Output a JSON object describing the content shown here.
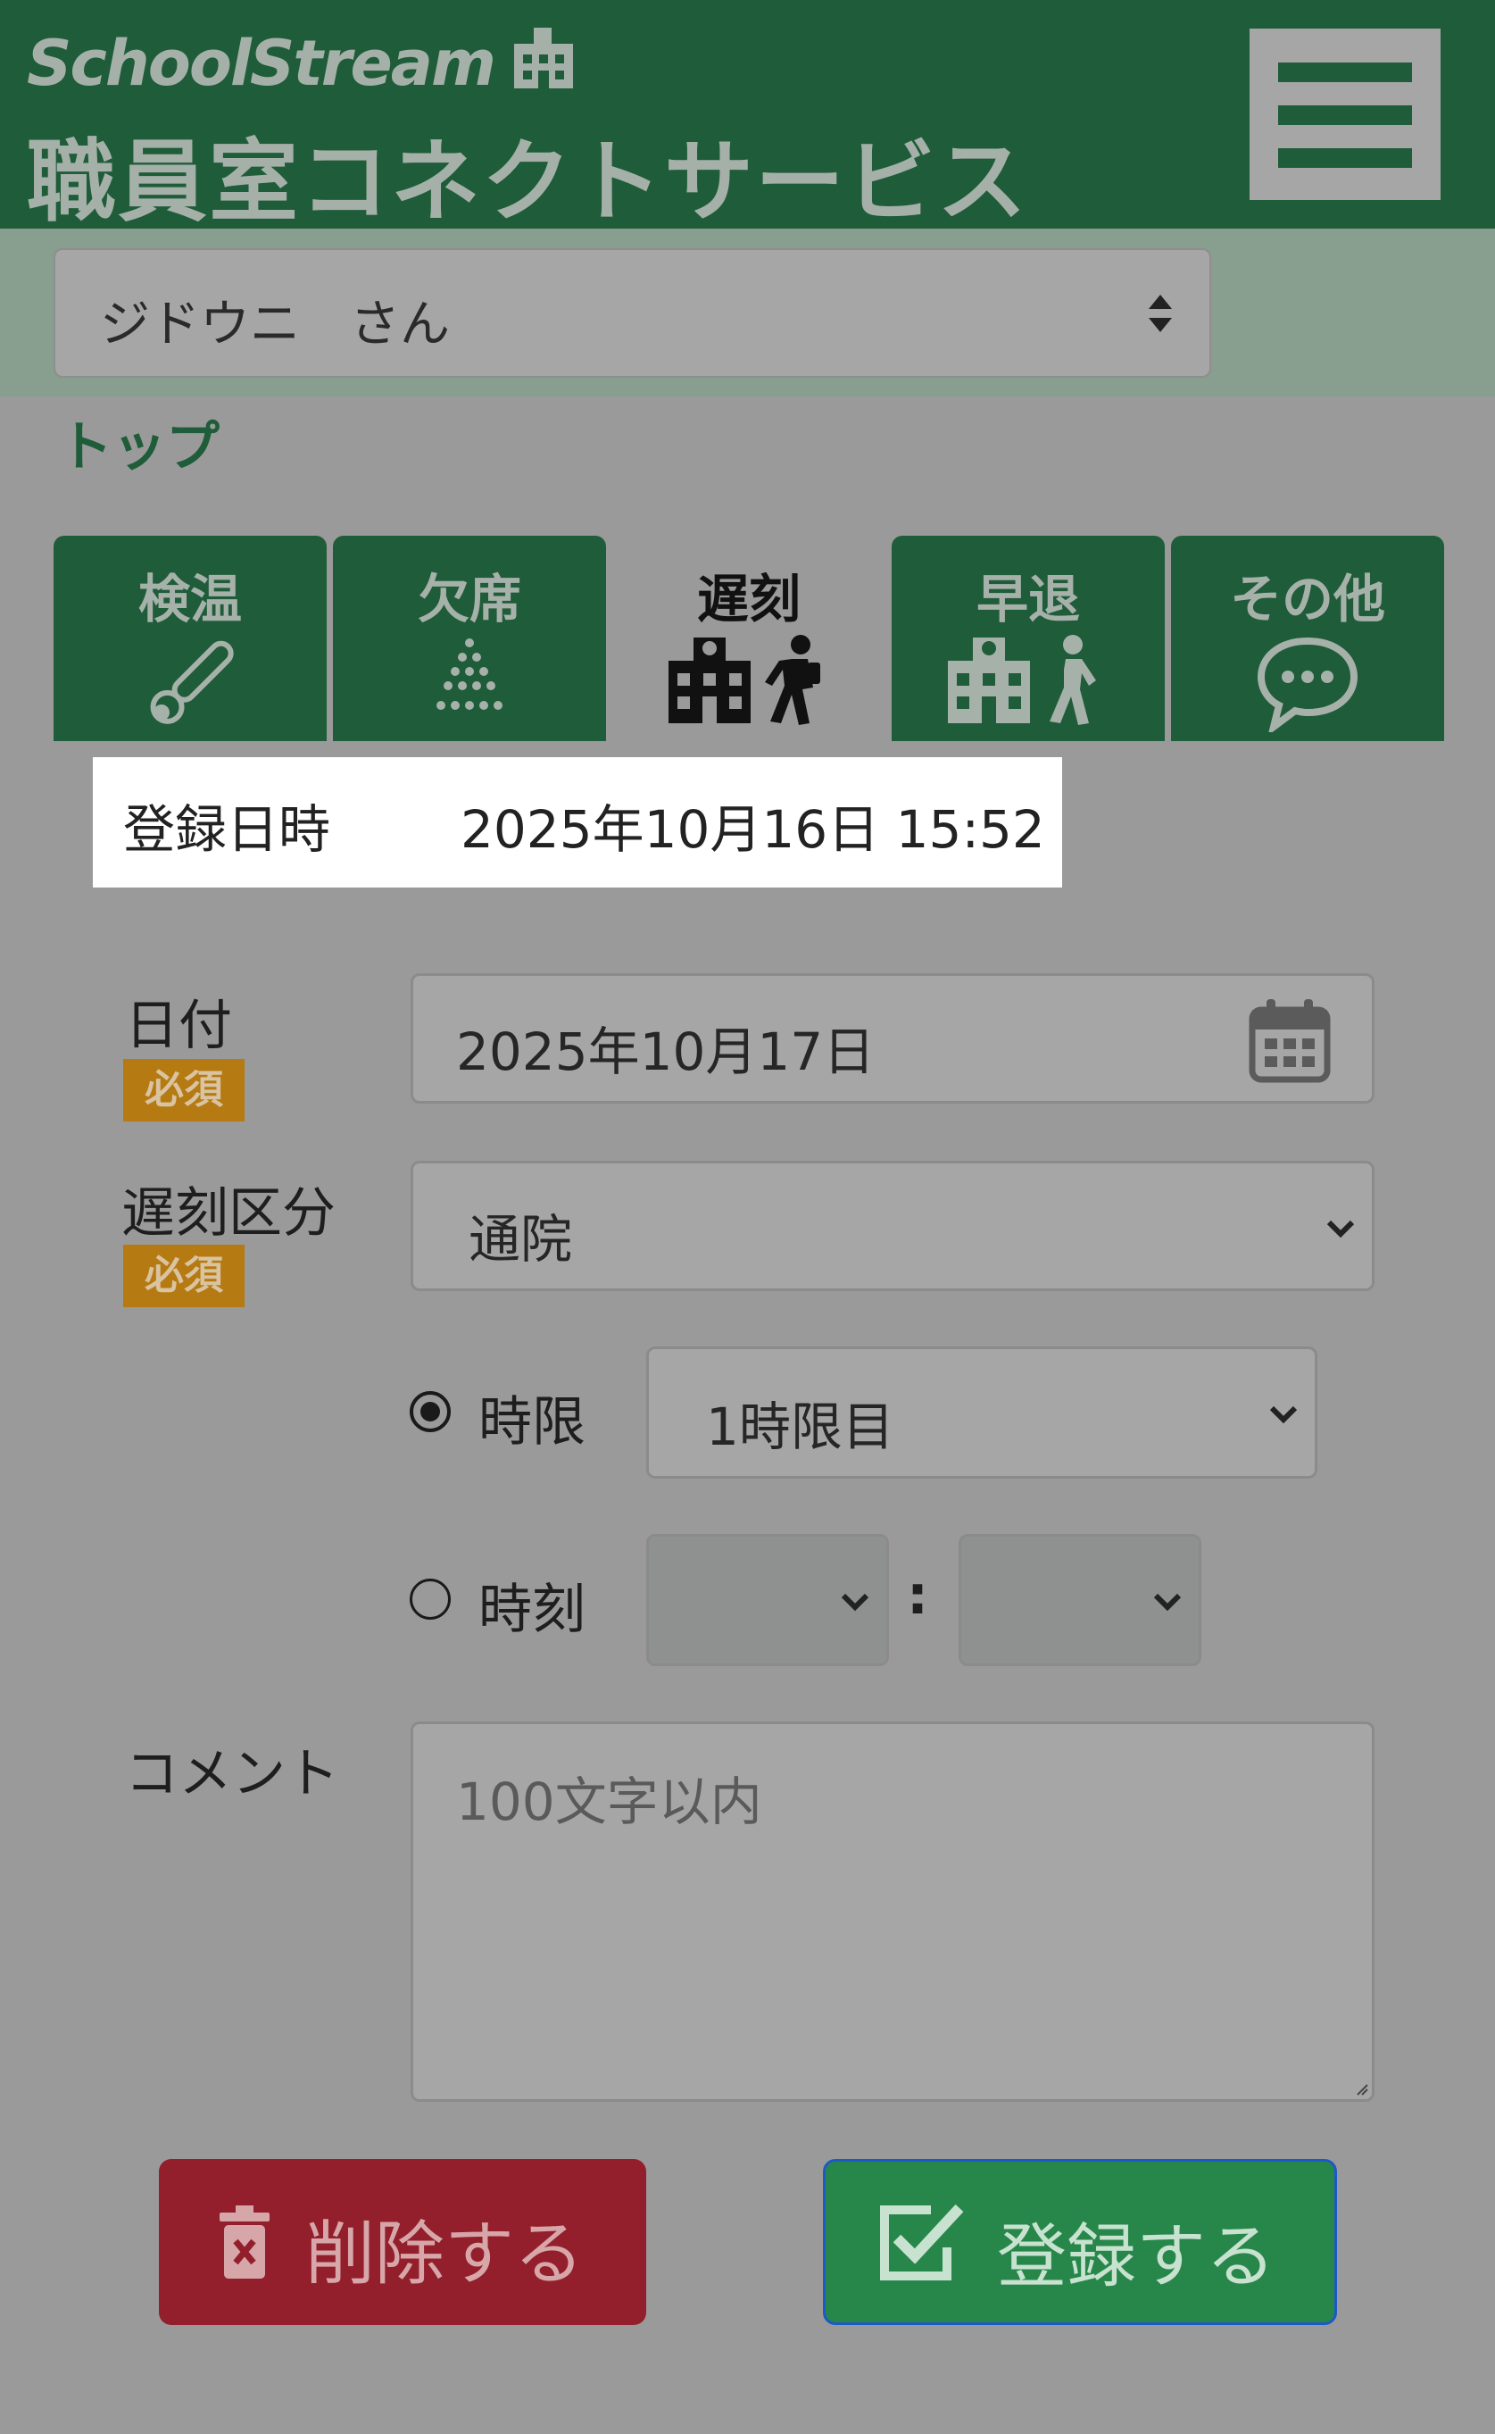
{
  "header": {
    "brand_name": "SchoolStream",
    "service_name": "職員室コネクトサービス",
    "colors": {
      "header_bg": "#1f5c39",
      "header_text": "#a5b0a9"
    }
  },
  "student_select": {
    "selected": "ジドウニ　さん"
  },
  "breadcrumb": "トップ",
  "tabs": [
    {
      "label": "検温",
      "icon": "thermometer-icon",
      "active": false
    },
    {
      "label": "欠席",
      "icon": "dots-triangle-icon",
      "active": false
    },
    {
      "label": "遅刻",
      "icon": "school-walker-icon",
      "active": true
    },
    {
      "label": "早退",
      "icon": "school-walker-icon",
      "active": false
    },
    {
      "label": "その他",
      "icon": "speech-bubble-icon",
      "active": false
    }
  ],
  "registration": {
    "label": "登録日時",
    "value": "2025年10月16日 15:52"
  },
  "form": {
    "date": {
      "label": "日付",
      "required": "必須",
      "value": "2025年10月17日",
      "icon": "calendar-icon"
    },
    "category": {
      "label": "遅刻区分",
      "required": "必須",
      "selected": "通院"
    },
    "period": {
      "label": "時限",
      "checked": true,
      "selected": "1時限目"
    },
    "time": {
      "label": "時刻",
      "checked": false,
      "hour": "",
      "minute": "",
      "separator": ":"
    },
    "comment": {
      "label": "コメント",
      "placeholder": "100文字以内",
      "value": ""
    }
  },
  "buttons": {
    "delete": {
      "label": "削除する",
      "icon": "trash-icon",
      "color": "#921f2b"
    },
    "submit": {
      "label": "登録する",
      "icon": "checkbox-icon",
      "color": "#27874a"
    }
  }
}
